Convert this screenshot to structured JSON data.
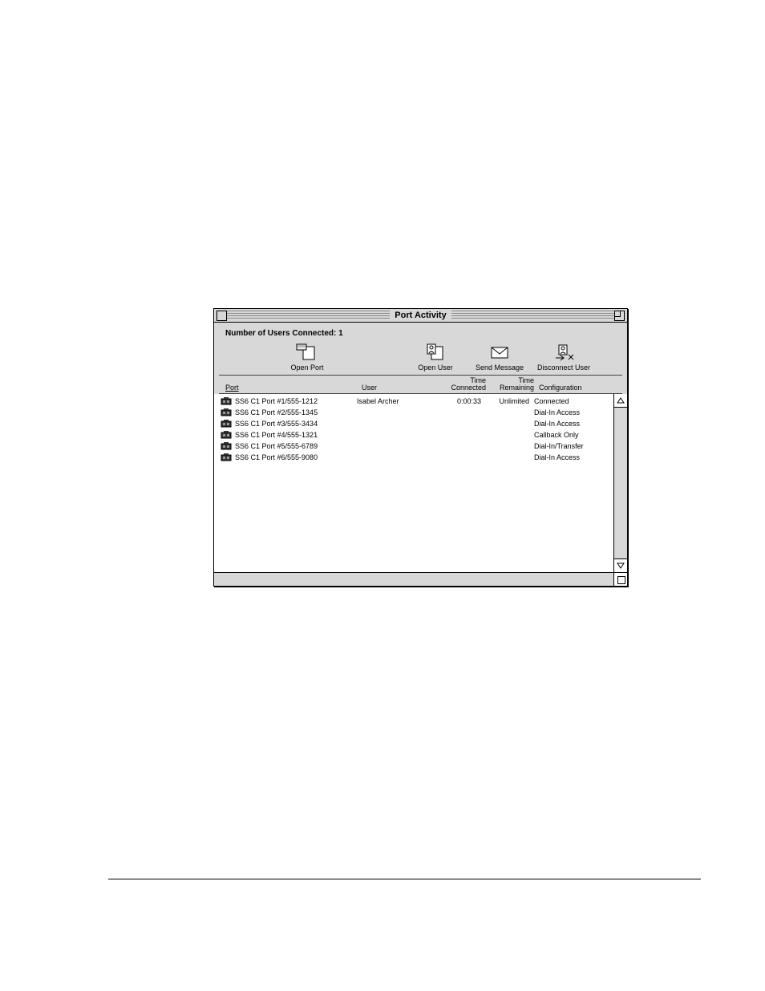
{
  "window": {
    "title": "Port Activity"
  },
  "status": {
    "label_prefix": "Number of Users Connected:",
    "count": "1"
  },
  "toolbar": {
    "open_port": {
      "label": "Open Port"
    },
    "open_user": {
      "label": "Open User"
    },
    "send_message": {
      "label": "Send Message"
    },
    "disconnect_user": {
      "label": "Disconnect User"
    }
  },
  "columns": {
    "port": "Port",
    "user": "User",
    "tc_line1": "Time",
    "tc_line2": "Connected",
    "tr_line1": "Time",
    "tr_line2": "Remaining",
    "cfg": "Configuration"
  },
  "rows": [
    {
      "port": "SS6 C1 Port #1/555-1212",
      "user": "Isabel Archer",
      "tc": "0:00:33",
      "tr": "Unlimited",
      "cfg": "Connected"
    },
    {
      "port": "SS6 C1 Port #2/555-1345",
      "user": "",
      "tc": "",
      "tr": "",
      "cfg": "Dial-In Access"
    },
    {
      "port": "SS6 C1 Port #3/555-3434",
      "user": "",
      "tc": "",
      "tr": "",
      "cfg": "Dial-In Access"
    },
    {
      "port": "SS6 C1 Port #4/555-1321",
      "user": "",
      "tc": "",
      "tr": "",
      "cfg": "Callback Only"
    },
    {
      "port": "SS6 C1 Port #5/555-6789",
      "user": "",
      "tc": "",
      "tr": "",
      "cfg": "Dial-In/Transfer"
    },
    {
      "port": "SS6 C1 Port #6/555-9080",
      "user": "",
      "tc": "",
      "tr": "",
      "cfg": "Dial-In Access"
    }
  ]
}
